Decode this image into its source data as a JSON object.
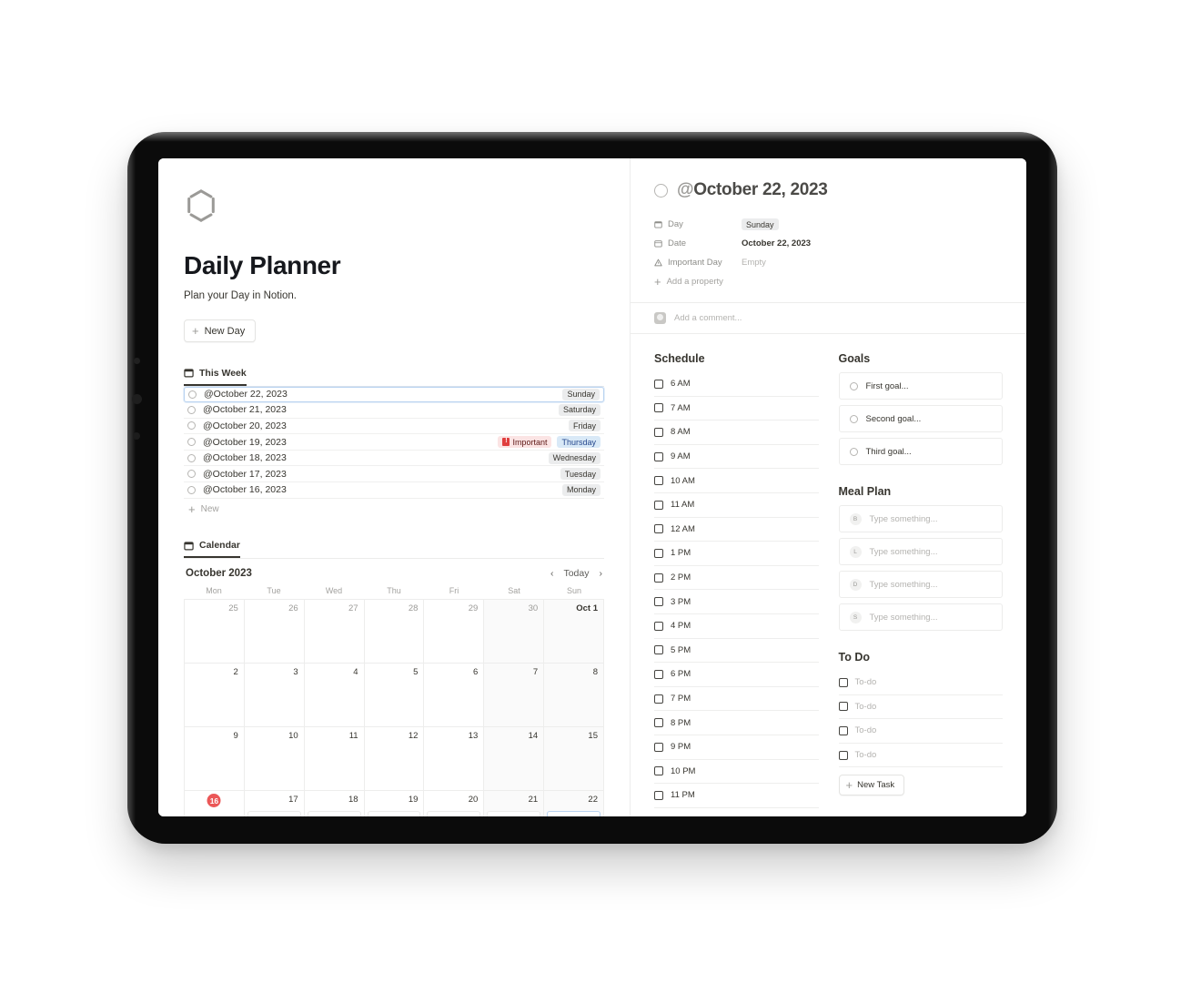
{
  "app": {
    "logo_icon": "hexagon-outline-icon",
    "title": "Daily Planner",
    "subtitle": "Plan your Day in Notion.",
    "new_day_label": "New Day"
  },
  "week_view": {
    "tab_label": "This Week",
    "tab_icon": "calendar-icon",
    "new_row_label": "New",
    "rows": [
      {
        "title": "@October 22, 2023",
        "day": "Sunday",
        "important": null,
        "selected": true,
        "day_color": "#ebeced"
      },
      {
        "title": "@October 21, 2023",
        "day": "Saturday",
        "important": null,
        "selected": false,
        "day_color": "#ebeced"
      },
      {
        "title": "@October 20, 2023",
        "day": "Friday",
        "important": null,
        "selected": false,
        "day_color": "#ebeced"
      },
      {
        "title": "@October 19, 2023",
        "day": "Thursday",
        "important": "Important",
        "selected": false,
        "day_color": "#d9e9f7"
      },
      {
        "title": "@October 18, 2023",
        "day": "Wednesday",
        "important": null,
        "selected": false,
        "day_color": "#ebeced"
      },
      {
        "title": "@October 17, 2023",
        "day": "Tuesday",
        "important": null,
        "selected": false,
        "day_color": "#ebeced"
      },
      {
        "title": "@October 16, 2023",
        "day": "Monday",
        "important": null,
        "selected": false,
        "day_color": "#ebeced"
      }
    ]
  },
  "calendar_view": {
    "tab_label": "Calendar",
    "tab_icon": "calendar-icon",
    "month_label": "October 2023",
    "today_label": "Today",
    "prev_icon": "chevron-left-icon",
    "next_icon": "chevron-right-icon",
    "day_names": [
      "Mon",
      "Tue",
      "Wed",
      "Thu",
      "Fri",
      "Sat",
      "Sun"
    ],
    "today_date": "16",
    "weeks": [
      [
        {
          "n": "25",
          "muted": true,
          "weekend": false
        },
        {
          "n": "26",
          "muted": true,
          "weekend": false
        },
        {
          "n": "27",
          "muted": true,
          "weekend": false
        },
        {
          "n": "28",
          "muted": true,
          "weekend": false
        },
        {
          "n": "29",
          "muted": true,
          "weekend": false
        },
        {
          "n": "30",
          "muted": true,
          "weekend": true
        },
        {
          "n": "Oct 1",
          "muted": false,
          "weekend": true,
          "bold": true
        }
      ],
      [
        {
          "n": "2",
          "muted": false,
          "weekend": false
        },
        {
          "n": "3",
          "muted": false,
          "weekend": false
        },
        {
          "n": "4",
          "muted": false,
          "weekend": false
        },
        {
          "n": "5",
          "muted": false,
          "weekend": false
        },
        {
          "n": "6",
          "muted": false,
          "weekend": false
        },
        {
          "n": "7",
          "muted": false,
          "weekend": true
        },
        {
          "n": "8",
          "muted": false,
          "weekend": true
        }
      ],
      [
        {
          "n": "9",
          "muted": false,
          "weekend": false
        },
        {
          "n": "10",
          "muted": false,
          "weekend": false
        },
        {
          "n": "11",
          "muted": false,
          "weekend": false
        },
        {
          "n": "12",
          "muted": false,
          "weekend": false
        },
        {
          "n": "13",
          "muted": false,
          "weekend": false
        },
        {
          "n": "14",
          "muted": false,
          "weekend": true
        },
        {
          "n": "15",
          "muted": false,
          "weekend": true
        }
      ],
      [
        {
          "n": "16",
          "muted": false,
          "weekend": false,
          "today": true
        },
        {
          "n": "17",
          "muted": false,
          "weekend": false
        },
        {
          "n": "18",
          "muted": false,
          "weekend": false
        },
        {
          "n": "19",
          "muted": false,
          "weekend": false
        },
        {
          "n": "20",
          "muted": false,
          "weekend": false
        },
        {
          "n": "21",
          "muted": false,
          "weekend": true
        },
        {
          "n": "22",
          "muted": false,
          "weekend": true,
          "highlight": true
        }
      ]
    ]
  },
  "detail": {
    "page_icon": "circle-outline-icon",
    "title_prefix": "@",
    "title": "October 22, 2023",
    "properties": [
      {
        "icon": "calendar-icon",
        "label": "Day",
        "value": "Sunday",
        "type": "tag"
      },
      {
        "icon": "date-icon",
        "label": "Date",
        "value": "October 22, 2023",
        "type": "text"
      },
      {
        "icon": "warning-icon",
        "label": "Important Day",
        "value": "Empty",
        "type": "empty"
      }
    ],
    "add_property_label": "Add a property",
    "comment_placeholder": "Add a comment...",
    "comment_avatar_icon": "user-avatar-icon"
  },
  "schedule": {
    "title": "Schedule",
    "slots": [
      "6 AM",
      "7 AM",
      "8 AM",
      "9 AM",
      "10 AM",
      "11 AM",
      "12 AM",
      "1 PM",
      "2 PM",
      "3 PM",
      "4 PM",
      "5 PM",
      "6 PM",
      "7 PM",
      "8 PM",
      "9 PM",
      "10 PM",
      "11 PM"
    ]
  },
  "goals": {
    "title": "Goals",
    "items": [
      "First goal...",
      "Second goal...",
      "Third goal..."
    ]
  },
  "meal_plan": {
    "title": "Meal Plan",
    "placeholder": "Type something...",
    "items": [
      {
        "badge": "B",
        "placeholder": "Type something..."
      },
      {
        "badge": "L",
        "placeholder": "Type something..."
      },
      {
        "badge": "D",
        "placeholder": "Type something..."
      },
      {
        "badge": "S",
        "placeholder": "Type something..."
      }
    ]
  },
  "todo": {
    "title": "To Do",
    "items": [
      "To-do",
      "To-do",
      "To-do",
      "To-do"
    ],
    "new_task_label": "New Task"
  },
  "colors": {
    "accent_red": "#eb5757",
    "accent_blue": "#d9e9f7",
    "important_bg": "#fbe4e4",
    "text": "#37352f",
    "muted": "#9b9a97"
  }
}
